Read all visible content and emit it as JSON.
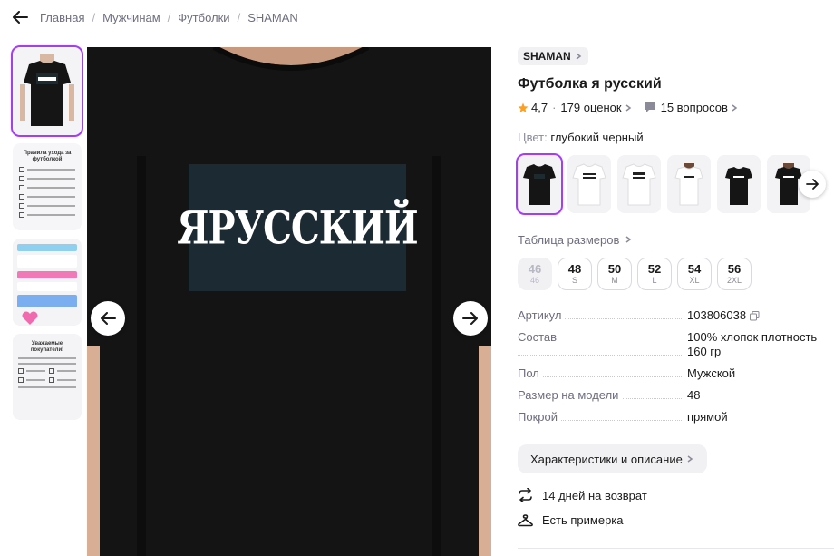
{
  "breadcrumbs": [
    "Главная",
    "Мужчинам",
    "Футболки",
    "SHAMAN"
  ],
  "product": {
    "brand": "SHAMAN",
    "title": "Футболка я русский",
    "rating": "4,7",
    "reviews": "179 оценок",
    "questions": "15 вопросов",
    "print_text": "ЯРУССКИЙ"
  },
  "color": {
    "label": "Цвет:",
    "value": "глубокий черный"
  },
  "size_table_label": "Таблица размеров",
  "sizes": [
    {
      "n": "46",
      "s": "46",
      "available": false
    },
    {
      "n": "48",
      "s": "S",
      "available": true
    },
    {
      "n": "50",
      "s": "M",
      "available": true
    },
    {
      "n": "52",
      "s": "L",
      "available": true
    },
    {
      "n": "54",
      "s": "XL",
      "available": true
    },
    {
      "n": "56",
      "s": "2XL",
      "available": true
    }
  ],
  "specs": [
    {
      "k": "Артикул",
      "v": "103806038"
    },
    {
      "k": "Состав",
      "v": "100% хлопок плотность 160 гр"
    },
    {
      "k": "Пол",
      "v": "Мужской"
    },
    {
      "k": "Размер на модели",
      "v": "48"
    },
    {
      "k": "Покрой",
      "v": "прямой"
    }
  ],
  "description_button": "Характеристики и описание",
  "features": {
    "returns": "14 дней на возврат",
    "fitting": "Есть примерка"
  },
  "thumbnails": {
    "care_title": "Правила ухода за футболкой",
    "notice_title": "Уважаемые покупатели!"
  },
  "colors": {
    "accent": "#a73afd",
    "star": "#ff9f1c"
  },
  "icons": [
    "arrow-left-icon",
    "chevron-right-icon",
    "star-icon",
    "question-bubble-icon",
    "copy-icon",
    "return-arrows-icon",
    "hanger-icon",
    "arrow-right-icon"
  ]
}
